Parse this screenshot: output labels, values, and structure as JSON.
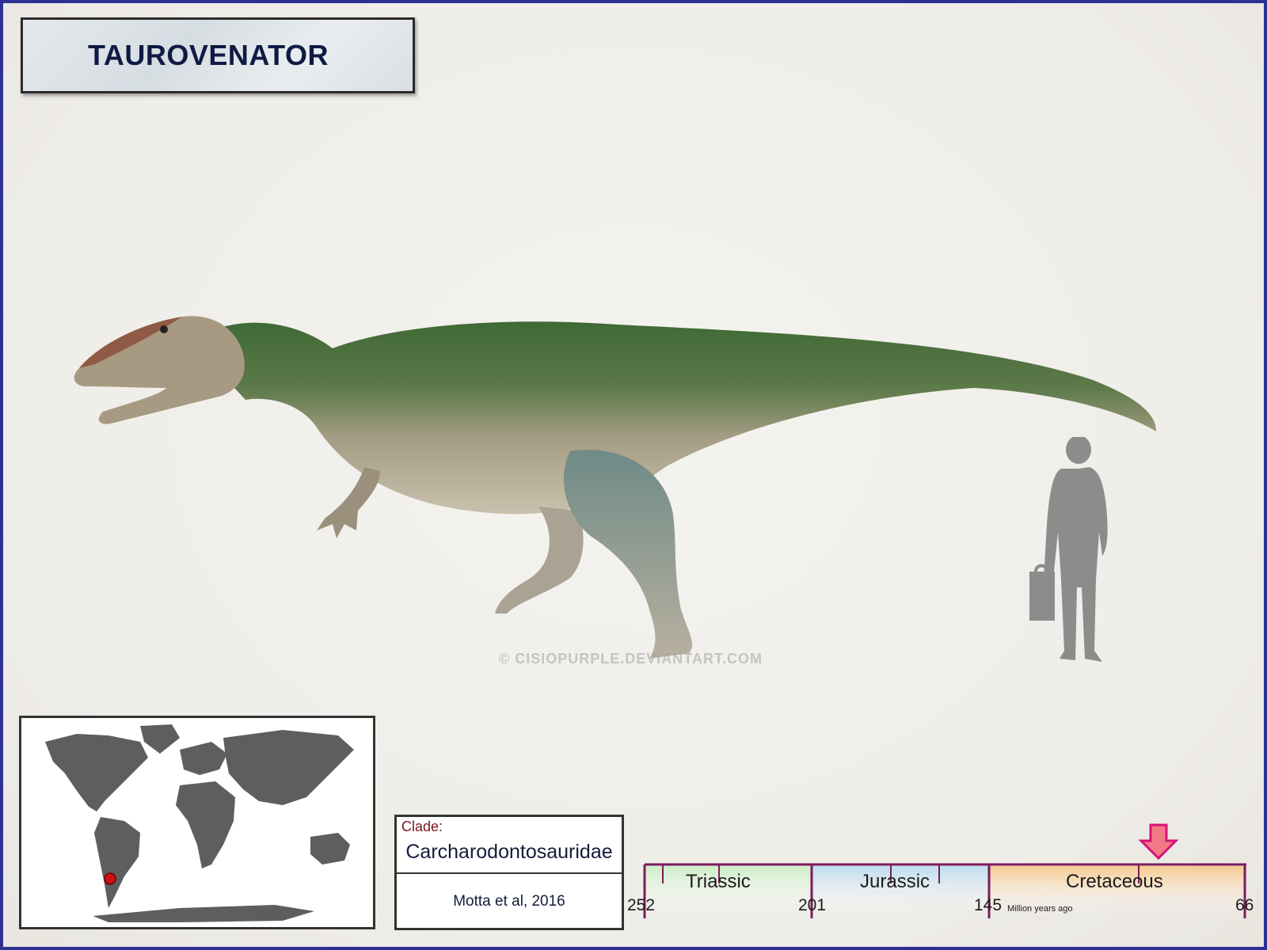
{
  "title": "TAUROVENATOR",
  "watermark": "© CISIOPURPLE.DEVIANTART.COM",
  "clade": {
    "label": "Clade:",
    "name": "Carcharodontosauridae",
    "citation": "Motta et al, 2016"
  },
  "timeline": {
    "periods": [
      {
        "name": "Triassic",
        "color": "#cdeec7"
      },
      {
        "name": "Jurassic",
        "color": "#bcdcef"
      },
      {
        "name": "Cretaceous",
        "color": "#f7c98d"
      }
    ],
    "ticks": [
      "252",
      "201",
      "145",
      "66"
    ],
    "unit_label": "Million years ago",
    "frame_color": "#7a1c5a",
    "marker_color": "#f27a86"
  },
  "map": {
    "location_marker_color": "#d01010",
    "land_color": "#5e5e5e"
  },
  "colors": {
    "frame_border": "#2e3193",
    "title_text": "#0f1a44"
  }
}
